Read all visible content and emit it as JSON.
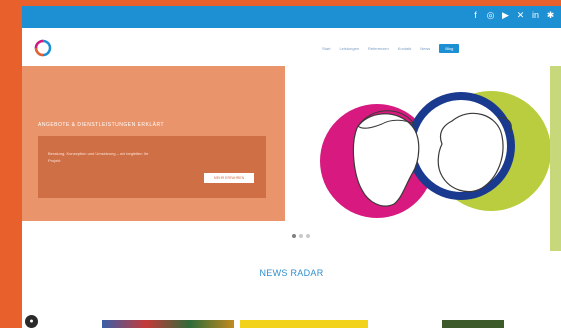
{
  "social_bar": {
    "icons": [
      "facebook-icon",
      "instagram-icon",
      "youtube-icon",
      "twitter-icon",
      "linkedin-icon",
      "xing-icon"
    ],
    "color": "#1d8fd3"
  },
  "nav": {
    "logo": "brand-logo",
    "items": [
      "Start",
      "Leistungen",
      "Referenzen",
      "Kontakt",
      "News"
    ],
    "cta_label": "Blog"
  },
  "hero": {
    "heading": "ANGEBOTE & DIENSTLEISTUNGEN ERKLÄRT",
    "text": "Beratung, Konzeption und Umsetzung – wir begleiten Ihr Projekt",
    "button_label": "MEHR ERFAHREN",
    "slide_count": 3,
    "active_slide": 1,
    "colors": {
      "panel": "#e9946a",
      "box": "#cf6f45",
      "magenta": "#d8197f",
      "lime": "#b9cd3e",
      "navy": "#1a3a8f"
    }
  },
  "section": {
    "title": "NEWS RADAR"
  },
  "chat": {
    "icon": "chat-icon"
  },
  "frame_color": "#e8612c"
}
